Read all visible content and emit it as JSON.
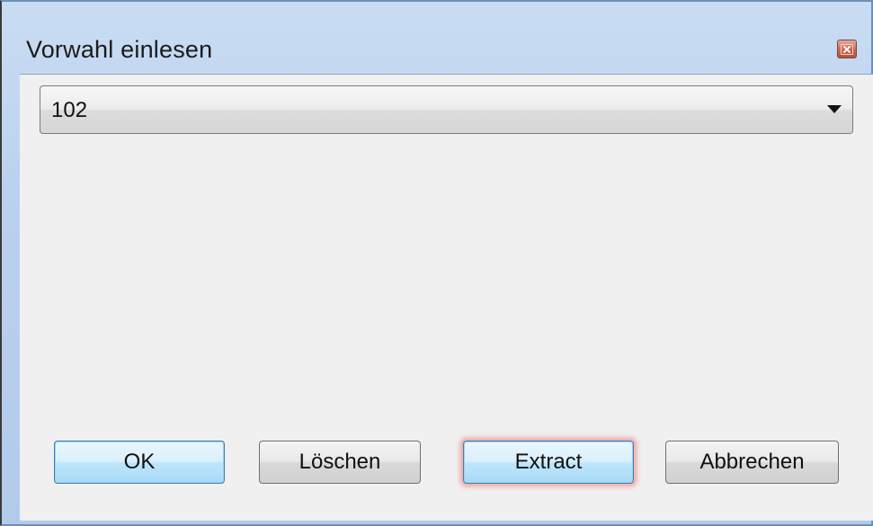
{
  "window": {
    "title": "Vorwahl einlesen",
    "close_icon": "close-icon"
  },
  "combo": {
    "selected_value": "102",
    "arrow_icon": "chevron-down-icon"
  },
  "buttons": {
    "ok": "OK",
    "delete": "Löschen",
    "extract": "Extract",
    "cancel": "Abbrechen"
  },
  "colors": {
    "titlebar": "#b9d1ee",
    "client_background": "#f0f0f0",
    "close_button": "#d26a58",
    "focus_glow": "#f0a0a0",
    "default_button": "#bee6fd"
  }
}
